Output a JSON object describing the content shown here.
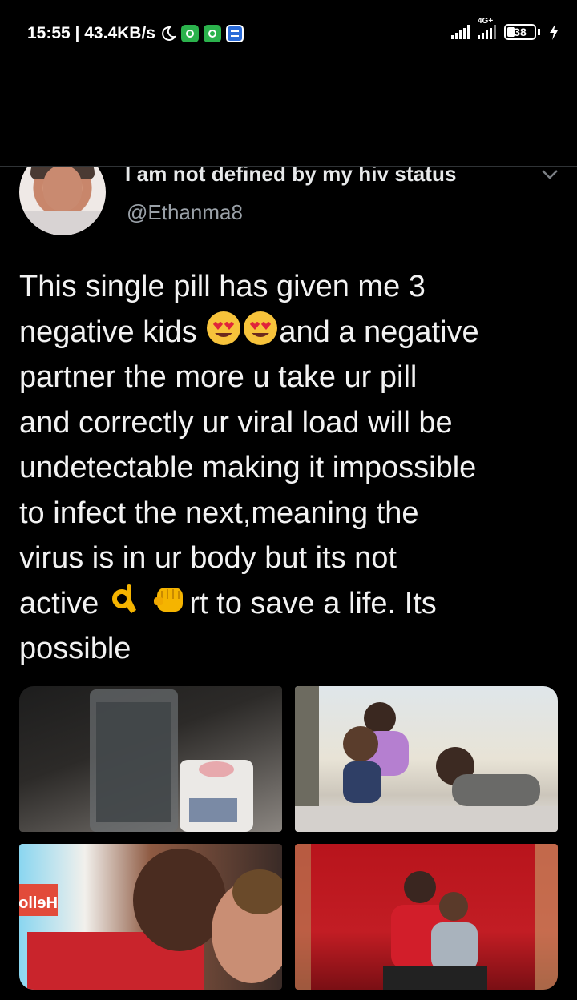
{
  "status_bar": {
    "time_speed": "15:55 | 43.4KB/s",
    "network_type": "4G+",
    "battery": "38",
    "icons": [
      "moon-icon",
      "whatsapp-icon",
      "whatsapp-icon",
      "message-icon",
      "signal-icon",
      "signal-4g-icon",
      "battery-icon",
      "charging-icon"
    ]
  },
  "tweet": {
    "display_name": "I am not defined by my hiv status",
    "handle": "@Ethanma8",
    "text_lines": [
      "This single pill has given me 3",
      "negative kids",
      "and a negative",
      "partner the more u take ur pill",
      "and correctly ur viral load will be",
      "undetectable making it impossible",
      "to infect the next,meaning the",
      "virus is in ur body but its not",
      "active",
      "rt to save a life. Its",
      "possible"
    ],
    "emojis": [
      "heart-eyes-emoji",
      "heart-eyes-emoji",
      "ok-hand-emoji",
      "fist-bump-emoji"
    ],
    "media": [
      {
        "name": "photo-pill-and-water"
      },
      {
        "name": "photo-kids-at-beach"
      },
      {
        "name": "photo-couple-kissing"
      },
      {
        "name": "photo-kids-on-red-chair"
      }
    ],
    "photo_sign_text": "Hello"
  },
  "colors": {
    "background": "#000000",
    "text": "#f2f2f2",
    "handle": "#9aa1a8",
    "divider": "#2f3336"
  }
}
